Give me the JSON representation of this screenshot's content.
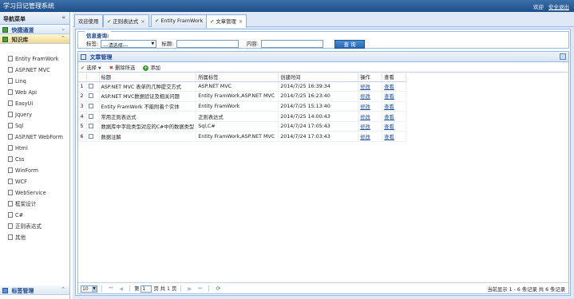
{
  "app": {
    "title": "学习日记管理系统",
    "welcome": "欢迎",
    "logout": "安全退出"
  },
  "sidebar": {
    "title": "导航菜单",
    "collapse_glyph": "«",
    "panels": [
      {
        "label": "快捷通道",
        "chevron": "⌄"
      },
      {
        "label": "知识库",
        "chevron": "⌃"
      }
    ],
    "items": [
      {
        "label": "Entity FramWork"
      },
      {
        "label": "ASP.NET MVC"
      },
      {
        "label": "Linq"
      },
      {
        "label": "Web Api"
      },
      {
        "label": "EasyUi"
      },
      {
        "label": "Jquery"
      },
      {
        "label": "Sql"
      },
      {
        "label": "ASP.NET WebForm"
      },
      {
        "label": "Html"
      },
      {
        "label": "Css"
      },
      {
        "label": "WinForm"
      },
      {
        "label": "WCF"
      },
      {
        "label": "WebService"
      },
      {
        "label": "框架设计"
      },
      {
        "label": "C#"
      },
      {
        "label": "正则表达式"
      },
      {
        "label": "其他"
      }
    ],
    "bottom_panel": {
      "label": "标签管理",
      "chevron": "⌃"
    }
  },
  "tabs": [
    {
      "label": "欢迎使用",
      "active": false,
      "checked": false,
      "closable": false
    },
    {
      "label": "正则表达式",
      "active": false,
      "checked": true,
      "closable": true
    },
    {
      "label": "Entity FramWork",
      "active": false,
      "checked": true,
      "closable": true
    },
    {
      "label": "文章管理",
      "active": true,
      "checked": true,
      "closable": true
    }
  ],
  "query": {
    "legend": "信息查询:",
    "tag_label": "标签:",
    "tag_select": "---请选择---",
    "title_label": "标题:",
    "content_label": "内容:",
    "search_button": "查 询"
  },
  "grid": {
    "title": "文章管理",
    "toolbar": {
      "select": "选择",
      "delete": "删除所选",
      "add": "添加"
    },
    "columns": [
      "",
      "标题",
      "所属标签",
      "创建时间",
      "操作",
      "查看"
    ],
    "rows": [
      {
        "no": "1",
        "title": "ASP.NET MVC 表单的几种提交方式",
        "tags": "ASP.NET MVC",
        "created": "2014/7/25 16:39:34",
        "action": "修改",
        "view": "查看"
      },
      {
        "no": "2",
        "title": "ASP.NET MVC数据验证及相关问题",
        "tags": "Entity FramWork,ASP.NET MVC",
        "created": "2014/7/25 16:23:40",
        "action": "修改",
        "view": "查看"
      },
      {
        "no": "3",
        "title": "Entity FramWork 不能附着个实体",
        "tags": "Entity FramWork",
        "created": "2014/7/25 15:13:40",
        "action": "修改",
        "view": "查看"
      },
      {
        "no": "4",
        "title": "常用正则表达式",
        "tags": "正则表达式",
        "created": "2014/7/25 14:00:43",
        "action": "修改",
        "view": "查看"
      },
      {
        "no": "5",
        "title": "数据库中字段类型对应的C#中的数据类型",
        "tags": "Sql,C#",
        "created": "2014/7/24 17:05:43",
        "action": "修改",
        "view": "查看"
      },
      {
        "no": "6",
        "title": "数据注解",
        "tags": "Entity FramWork,ASP.NET MVC",
        "created": "2014/7/24 17:03:43",
        "action": "修改",
        "view": "查看"
      }
    ]
  },
  "pager": {
    "page_size": "10",
    "page_prefix": "第",
    "page_number": "1",
    "page_suffix": "页 共 1 页",
    "info": "当前显示 1 - 6 条记录 共 6 条记录"
  }
}
